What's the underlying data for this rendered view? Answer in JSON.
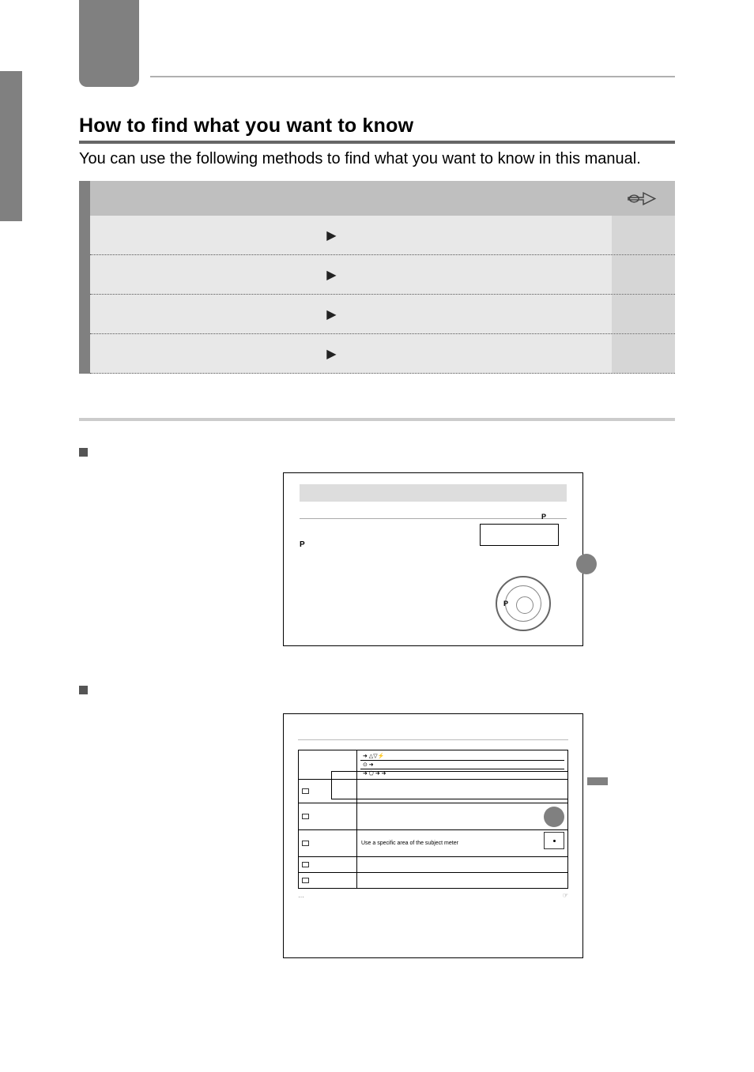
{
  "section": {
    "title": "How to find what you want to know",
    "intro": "You can use the following methods to find what you want to know in this manual."
  },
  "table": {
    "head_icon": "pointing-hand-icon",
    "rows": [
      {
        "label": "",
        "arrow": "▶",
        "page": ""
      },
      {
        "label": "",
        "arrow": "▶",
        "page": ""
      },
      {
        "label": "",
        "arrow": "▶",
        "page": ""
      },
      {
        "label": "",
        "arrow": "▶",
        "page": ""
      }
    ]
  },
  "sub1": {
    "heading": "",
    "desc": ""
  },
  "sample1": {
    "mode_label": "P",
    "set_label": "P"
  },
  "sub2": {
    "heading": "",
    "desc": ""
  },
  "sample2": {
    "icon_note": "",
    "headrow_a": "",
    "headrow_b1": "➜ △▽⚡",
    "headrow_b2": "⊙ ➜",
    "headrow_b3": "➜ ⬠ ➜        ➜",
    "rows": [
      {
        "a_icon": "grid",
        "a": "",
        "b": ""
      },
      {
        "a_icon": "square-dot",
        "a": "",
        "b": ""
      },
      {
        "a_icon": "square-dot",
        "a": "",
        "b": "Use a specific area of the subject meter"
      },
      {
        "a_icon": "square-dot",
        "a": "",
        "b": ""
      },
      {
        "a_icon": "square-dot",
        "a": "",
        "b": ""
      }
    ],
    "footer_left": "…",
    "footer_right": "☞"
  }
}
